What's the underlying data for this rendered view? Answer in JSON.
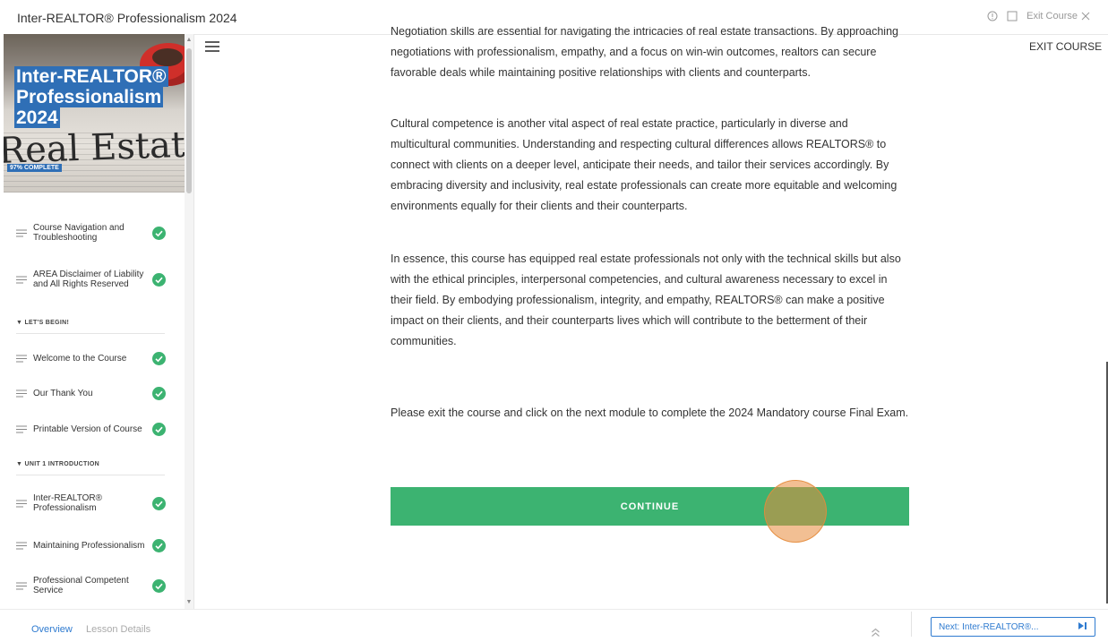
{
  "header": {
    "course_title": "Inter-REALTOR® Professionalism 2024",
    "exit_label": "Exit Course"
  },
  "sidebar": {
    "hero": {
      "title_lines": [
        "Inter-REALTOR®",
        "Professionalism",
        "2024"
      ],
      "newspaper_text": "Real Estate",
      "progress": "97% COMPLETE",
      "progress_value": 97
    },
    "items": [
      {
        "label": "Course Navigation and Troubleshooting",
        "completed": true
      },
      {
        "label": "AREA Disclaimer of Liability and All Rights Reserved",
        "completed": true
      },
      {
        "section": "LET'S BEGIN!"
      },
      {
        "label": "Welcome to the Course",
        "completed": true
      },
      {
        "label": "Our Thank You",
        "completed": true
      },
      {
        "label": "Printable Version of Course",
        "completed": true
      },
      {
        "section": "UNIT 1 INTRODUCTION"
      },
      {
        "label": "Inter-REALTOR® Professionalism",
        "completed": true
      },
      {
        "label": "Maintaining Professionalism",
        "completed": true
      },
      {
        "label": "Professional Competent Service",
        "completed": true
      }
    ]
  },
  "main": {
    "exit_course_label": "EXIT COURSE",
    "paragraphs": [
      "Negotiation skills are essential for navigating the intricacies of real estate transactions. By approaching negotiations with professionalism, empathy, and a focus on win-win outcomes, realtors can secure favorable deals while maintaining positive relationships with clients and counterparts.",
      "Cultural competence is another vital aspect of real estate practice, particularly in diverse and multicultural communities. Understanding and respecting cultural differences allows REALTORS® to connect with clients on a deeper level, anticipate their needs, and tailor their services accordingly. By embracing diversity and inclusivity, real estate professionals can create more equitable and welcoming environments equally for their clients and their counterparts.",
      "In essence, this course has equipped real estate professionals not only with the technical skills but also with the ethical principles, interpersonal competencies, and cultural awareness necessary to excel in their field. By embodying professionalism, integrity, and empathy, REALTORS® can make a positive impact on their clients, and their counterparts lives which will contribute to the betterment of their communities.",
      "Please exit the course and click on the next module to complete the 2024 Mandatory course Final Exam."
    ],
    "continue_label": "CONTINUE"
  },
  "footer": {
    "tabs": [
      "Overview",
      "Lesson Details"
    ],
    "next_label": "Next: Inter-REALTOR®..."
  },
  "colors": {
    "accent_green": "#3cb371",
    "link_blue": "#2f7bd0",
    "hero_blue": "#2f6fb6",
    "click_indicator": "#e88a3a"
  },
  "icons": [
    "info-icon",
    "square-icon",
    "close-icon",
    "hamburger-menu-icon",
    "check-circle-icon",
    "chevron-double-up-icon",
    "skip-next-icon"
  ]
}
